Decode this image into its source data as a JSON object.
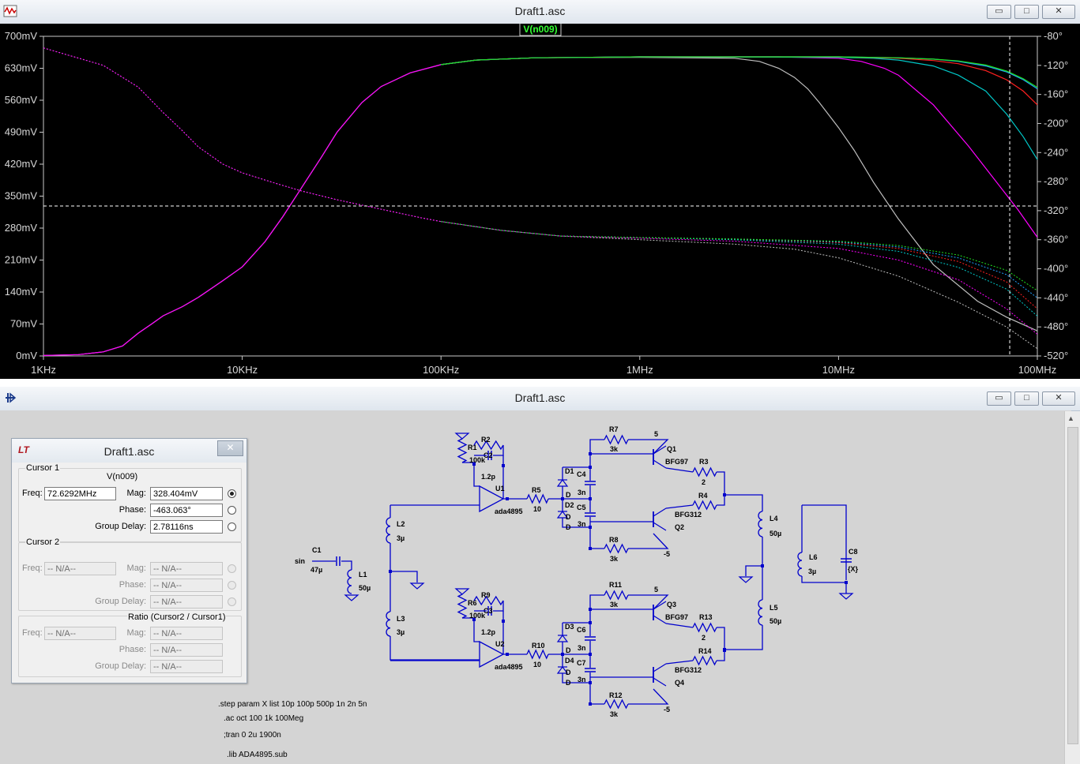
{
  "plot_window": {
    "title": "Draft1.asc",
    "buttons": {
      "minimize": "▭",
      "maximize": "□",
      "close": "✕"
    }
  },
  "schematic_window": {
    "title": "Draft1.asc",
    "buttons": {
      "minimize": "▭",
      "maximize": "□",
      "close": "✕"
    }
  },
  "chart_data": {
    "type": "line",
    "trace_label": "V(n009)",
    "x_scale": "log",
    "x_ticks": [
      "1KHz",
      "10KHz",
      "100KHz",
      "1MHz",
      "10MHz",
      "100MHz"
    ],
    "x_tick_values": [
      1000,
      10000,
      100000,
      1000000,
      10000000,
      100000000
    ],
    "y_left_ticks": [
      "700mV",
      "630mV",
      "560mV",
      "490mV",
      "420mV",
      "350mV",
      "280mV",
      "210mV",
      "140mV",
      "70mV",
      "0mV"
    ],
    "y_left_values": [
      700,
      630,
      560,
      490,
      420,
      350,
      280,
      210,
      140,
      70,
      0
    ],
    "y_right_ticks": [
      "-80°",
      "-120°",
      "-160°",
      "-200°",
      "-240°",
      "-280°",
      "-320°",
      "-360°",
      "-400°",
      "-440°",
      "-480°",
      "-520°"
    ],
    "y_right_values": [
      -80,
      -120,
      -160,
      -200,
      -240,
      -280,
      -320,
      -360,
      -400,
      -440,
      -480,
      -520
    ],
    "ylim_mV": [
      0,
      700
    ],
    "ylim_deg": [
      -520,
      -80
    ],
    "cursor": {
      "x_hz": 72629200,
      "y_mV": 328.404
    },
    "colors": {
      "background": "#000000",
      "axis": "#c8c8c8",
      "label_bg": "#00aa00",
      "label_fg": "#ffff00"
    },
    "series": [
      {
        "color": "#bfbfbf",
        "magnitude": [
          [
            1000,
            1
          ],
          [
            1500,
            3
          ],
          [
            2000,
            9
          ],
          [
            2500,
            22
          ],
          [
            3000,
            50
          ],
          [
            3500,
            70
          ],
          [
            4000,
            88
          ],
          [
            5000,
            108
          ],
          [
            6000,
            128
          ],
          [
            8000,
            165
          ],
          [
            10000,
            195
          ],
          [
            13000,
            250
          ],
          [
            16000,
            305
          ],
          [
            20000,
            370
          ],
          [
            25000,
            435
          ],
          [
            30000,
            490
          ],
          [
            40000,
            555
          ],
          [
            50000,
            590
          ],
          [
            70000,
            620
          ],
          [
            100000,
            638
          ],
          [
            150000,
            648
          ],
          [
            300000,
            653
          ],
          [
            1000000,
            654
          ],
          [
            3000000,
            652
          ],
          [
            4000000,
            645
          ],
          [
            5000000,
            630
          ],
          [
            6000000,
            610
          ],
          [
            7000000,
            585
          ],
          [
            8000000,
            555
          ],
          [
            10000000,
            500
          ],
          [
            12000000,
            450
          ],
          [
            15000000,
            380
          ],
          [
            20000000,
            300
          ],
          [
            30000000,
            200
          ],
          [
            50000000,
            120
          ],
          [
            70000000,
            85
          ],
          [
            100000000,
            55
          ]
        ],
        "phase": [
          [
            1000,
            -96
          ],
          [
            2000,
            -120
          ],
          [
            3000,
            -150
          ],
          [
            4000,
            -185
          ],
          [
            5000,
            -210
          ],
          [
            6000,
            -232
          ],
          [
            8000,
            -256
          ],
          [
            10000,
            -268
          ],
          [
            15000,
            -283
          ],
          [
            20000,
            -293
          ],
          [
            30000,
            -305
          ],
          [
            50000,
            -318
          ],
          [
            80000,
            -330
          ],
          [
            100000,
            -335
          ],
          [
            200000,
            -347
          ],
          [
            400000,
            -355
          ],
          [
            1000000,
            -360
          ],
          [
            3000000,
            -366
          ],
          [
            6000000,
            -373
          ],
          [
            10000000,
            -385
          ],
          [
            20000000,
            -410
          ],
          [
            40000000,
            -446
          ],
          [
            70000000,
            -480
          ],
          [
            100000000,
            -510
          ]
        ]
      },
      {
        "color": "#ff00ff",
        "magnitude": [
          [
            1000,
            1
          ],
          [
            1500,
            3
          ],
          [
            2000,
            9
          ],
          [
            2500,
            22
          ],
          [
            3000,
            50
          ],
          [
            3500,
            70
          ],
          [
            4000,
            88
          ],
          [
            5000,
            108
          ],
          [
            6000,
            128
          ],
          [
            8000,
            165
          ],
          [
            10000,
            195
          ],
          [
            13000,
            250
          ],
          [
            16000,
            305
          ],
          [
            20000,
            370
          ],
          [
            25000,
            435
          ],
          [
            30000,
            490
          ],
          [
            40000,
            555
          ],
          [
            50000,
            590
          ],
          [
            70000,
            620
          ],
          [
            100000,
            638
          ],
          [
            150000,
            648
          ],
          [
            300000,
            653
          ],
          [
            1000000,
            655
          ],
          [
            5000000,
            655
          ],
          [
            10000000,
            652
          ],
          [
            13000000,
            645
          ],
          [
            17000000,
            630
          ],
          [
            20000000,
            615
          ],
          [
            30000000,
            550
          ],
          [
            45000000,
            460
          ],
          [
            60000000,
            390
          ],
          [
            80000000,
            320
          ],
          [
            100000000,
            260
          ]
        ],
        "phase": [
          [
            1000,
            -96
          ],
          [
            2000,
            -120
          ],
          [
            3000,
            -150
          ],
          [
            4000,
            -185
          ],
          [
            5000,
            -210
          ],
          [
            6000,
            -232
          ],
          [
            8000,
            -256
          ],
          [
            10000,
            -268
          ],
          [
            15000,
            -283
          ],
          [
            20000,
            -293
          ],
          [
            30000,
            -305
          ],
          [
            50000,
            -318
          ],
          [
            80000,
            -330
          ],
          [
            100000,
            -335
          ],
          [
            200000,
            -347
          ],
          [
            400000,
            -355
          ],
          [
            1000000,
            -358
          ],
          [
            3000000,
            -362
          ],
          [
            10000000,
            -372
          ],
          [
            20000000,
            -388
          ],
          [
            40000000,
            -415
          ],
          [
            70000000,
            -455
          ],
          [
            100000000,
            -490
          ]
        ]
      },
      {
        "color": "#00c8c8",
        "magnitude": [
          [
            100000,
            638
          ],
          [
            150000,
            648
          ],
          [
            300000,
            653
          ],
          [
            1000000,
            655
          ],
          [
            10000000,
            654
          ],
          [
            15000000,
            652
          ],
          [
            20000000,
            648
          ],
          [
            30000000,
            635
          ],
          [
            40000000,
            615
          ],
          [
            55000000,
            580
          ],
          [
            70000000,
            530
          ],
          [
            85000000,
            480
          ],
          [
            100000000,
            430
          ]
        ],
        "phase": [
          [
            100000,
            -335
          ],
          [
            200000,
            -347
          ],
          [
            400000,
            -355
          ],
          [
            1000000,
            -357
          ],
          [
            3000000,
            -360
          ],
          [
            10000000,
            -366
          ],
          [
            20000000,
            -376
          ],
          [
            40000000,
            -398
          ],
          [
            70000000,
            -428
          ],
          [
            100000000,
            -465
          ]
        ]
      },
      {
        "color": "#ff2020",
        "magnitude": [
          [
            100000,
            638
          ],
          [
            150000,
            648
          ],
          [
            300000,
            653
          ],
          [
            1000000,
            655
          ],
          [
            10000000,
            655
          ],
          [
            20000000,
            652
          ],
          [
            30000000,
            647
          ],
          [
            40000000,
            640
          ],
          [
            55000000,
            625
          ],
          [
            70000000,
            605
          ],
          [
            85000000,
            580
          ],
          [
            100000000,
            550
          ]
        ],
        "phase": [
          [
            100000,
            -335
          ],
          [
            200000,
            -347
          ],
          [
            400000,
            -355
          ],
          [
            1000000,
            -357
          ],
          [
            3000000,
            -359
          ],
          [
            10000000,
            -364
          ],
          [
            20000000,
            -372
          ],
          [
            40000000,
            -390
          ],
          [
            70000000,
            -418
          ],
          [
            100000000,
            -455
          ]
        ]
      },
      {
        "color": "#20a0ff",
        "magnitude": [
          [
            100000,
            638
          ],
          [
            150000,
            648
          ],
          [
            300000,
            653
          ],
          [
            1000000,
            655
          ],
          [
            10000000,
            655
          ],
          [
            20000000,
            653
          ],
          [
            30000000,
            650
          ],
          [
            40000000,
            645
          ],
          [
            55000000,
            635
          ],
          [
            70000000,
            622
          ],
          [
            85000000,
            605
          ],
          [
            100000000,
            585
          ]
        ],
        "phase": [
          [
            100000,
            -335
          ],
          [
            200000,
            -347
          ],
          [
            400000,
            -355
          ],
          [
            1000000,
            -357
          ],
          [
            3000000,
            -359
          ],
          [
            10000000,
            -363
          ],
          [
            20000000,
            -370
          ],
          [
            40000000,
            -385
          ],
          [
            70000000,
            -408
          ],
          [
            100000000,
            -440
          ]
        ]
      },
      {
        "color": "#20e020",
        "magnitude": [
          [
            100000,
            638
          ],
          [
            150000,
            648
          ],
          [
            300000,
            653
          ],
          [
            1000000,
            655
          ],
          [
            10000000,
            655
          ],
          [
            20000000,
            653
          ],
          [
            30000000,
            650
          ],
          [
            40000000,
            646
          ],
          [
            55000000,
            637
          ],
          [
            70000000,
            624
          ],
          [
            85000000,
            607
          ],
          [
            100000000,
            588
          ]
        ],
        "phase": [
          [
            100000,
            -335
          ],
          [
            200000,
            -347
          ],
          [
            400000,
            -355
          ],
          [
            1000000,
            -357
          ],
          [
            3000000,
            -359
          ],
          [
            10000000,
            -362
          ],
          [
            20000000,
            -368
          ],
          [
            40000000,
            -381
          ],
          [
            70000000,
            -402
          ],
          [
            100000000,
            -430
          ]
        ]
      }
    ]
  },
  "cursor_dialog": {
    "title": "Draft1.asc",
    "close": "✕",
    "cursor1": {
      "group_label": "Cursor 1",
      "trace": "V(n009)",
      "freq_label": "Freq:",
      "freq_value": "72.6292MHz",
      "mag_label": "Mag:",
      "mag_value": "328.404mV",
      "phase_label": "Phase:",
      "phase_value": "-463.063°",
      "gd_label": "Group Delay:",
      "gd_value": "2.78116ns"
    },
    "cursor2": {
      "group_label": "Cursor 2",
      "freq_label": "Freq:",
      "freq_value": "-- N/A--",
      "mag_label": "Mag:",
      "mag_value": "-- N/A--",
      "phase_label": "Phase:",
      "phase_value": "-- N/A--",
      "gd_label": "Group Delay:",
      "gd_value": "-- N/A--"
    },
    "ratio": {
      "group_label": "Ratio (Cursor2 / Cursor1)",
      "freq_label": "Freq:",
      "freq_value": "-- N/A--",
      "mag_label": "Mag:",
      "mag_value": "-- N/A--",
      "phase_label": "Phase:",
      "phase_value": "-- N/A--",
      "gd_label": "Group Delay:",
      "gd_value": "-- N/A--"
    }
  },
  "schematic": {
    "wire_color": "#0000cc",
    "labels": {
      "r1": "R1",
      "r2": "R2",
      "c1": "C1",
      "c2": "C2",
      "c3": "C3",
      "c4": "C4",
      "c5": "C5",
      "c6": "C6",
      "c7": "C7",
      "c8": "C8",
      "r5": "R5",
      "r6": "R6",
      "r7": "R7",
      "r8": "R8",
      "r9": "R9",
      "r10": "R10",
      "r11": "R11",
      "r12": "R12",
      "r3": "R3",
      "r4": "R4",
      "r13": "R13",
      "r14": "R14",
      "l1": "L1",
      "l2": "L2",
      "l3": "L3",
      "l4": "L4",
      "l5": "L5",
      "l6": "L6",
      "d1": "D1",
      "d2": "D2",
      "d3": "D3",
      "d4": "D4",
      "q1": "Q1",
      "q2": "Q2",
      "q3": "Q3",
      "q4": "Q4",
      "u1": "U1",
      "u2": "U2",
      "v100k": "100k",
      "v1p2": "1.2p",
      "v10": "10",
      "v3k": "3k",
      "v3n": "3n",
      "v2": "2",
      "v47u": "47µ",
      "v50u": "50µ",
      "v3u": "3µ",
      "vX": "{X}",
      "vD": "D",
      "v5": "5",
      "vm5": "-5",
      "sin": "sin",
      "bfg97": "BFG97",
      "bfg312": "BFG312",
      "ada4895": "ada4895"
    },
    "directives": [
      ".step param X list 10p 100p 500p 1n 2n 5n",
      ".ac oct 100 1k 100Meg",
      ";tran 0 2u 1900n",
      ".lib ADA4895.sub"
    ]
  }
}
